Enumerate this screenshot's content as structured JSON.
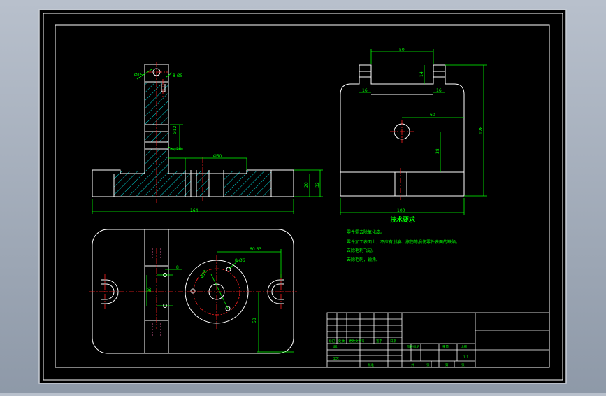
{
  "colors": {
    "background": "#000000",
    "outline": "#ffffff",
    "dimension": "#00ff00",
    "centerline": "#ff2020",
    "hatch": "#00e0e0",
    "viewport": "#9aa3b0"
  },
  "front_view": {
    "dims": {
      "overall_width": "164",
      "small_hole_dia": "Ø15",
      "tapped": "8-Ø5",
      "side_hole_dia": "Ø12",
      "step": "20",
      "slot_dia": "Ø50",
      "height_inner": "20",
      "height_outer": "32"
    }
  },
  "side_view": {
    "dims": {
      "top_span": "50",
      "lug_left": "16",
      "lug_right": "16",
      "lug_gap": "14",
      "hole_offset_x": "60",
      "hole_offset_y": "38",
      "overall_height": "128",
      "overall_width": "100"
    }
  },
  "top_view": {
    "dims": {
      "offset_to_hole": "60.63",
      "bolt_circle": "8-Ø6",
      "slot_pitch": "8",
      "hole_spacing": "30",
      "bore_dia": "Ø28",
      "vertical_offset": "58"
    }
  },
  "tech_requirements": {
    "title": "技术要求",
    "items": [
      "零件需去除氧化皮。",
      "零件加工表面上，不应有划痕、擦伤等损伤零件表面的缺陷。",
      "去除毛刺飞边。",
      "去除毛刺，锐角。"
    ]
  },
  "title_block": {
    "row_labels": [
      "标记",
      "处数",
      "更改文件号",
      "签字",
      "日期"
    ],
    "design_label": "设计",
    "stage_label": "阶段标记",
    "weight_label": "重量",
    "scale_label": "比例",
    "scale_value": "1:1",
    "process_label": "工艺",
    "approve_label": "批准",
    "sheet_total_label": "共",
    "sheet_label": "张",
    "page_label": "第",
    "page_sheet_label": "张"
  }
}
